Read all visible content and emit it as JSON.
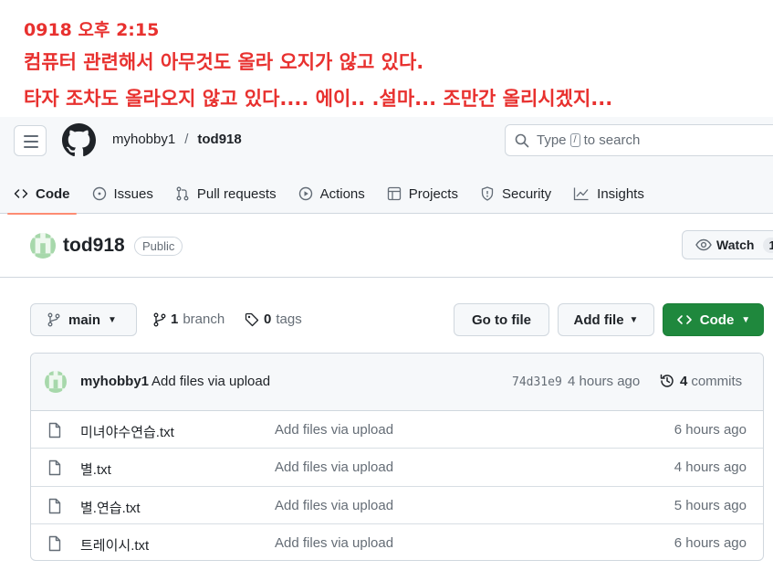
{
  "annotation": {
    "line1": "0918 오후 2:15",
    "line2": "컴퓨터 관련해서 아무것도 올라 오지가 않고 있다.",
    "line3": "타자 조차도 올라오지 않고 있다.... 에이.. .설마... 조만간 올리시겠지..."
  },
  "header": {
    "owner": "myhobby1",
    "separator": "/",
    "repo": "tod918",
    "search_prefix": "Type",
    "search_key": "/",
    "search_suffix": "to search"
  },
  "tabs": [
    {
      "label": "Code",
      "icon": "code-icon",
      "active": true
    },
    {
      "label": "Issues",
      "icon": "issue-icon"
    },
    {
      "label": "Pull requests",
      "icon": "pull-request-icon"
    },
    {
      "label": "Actions",
      "icon": "play-icon"
    },
    {
      "label": "Projects",
      "icon": "table-icon"
    },
    {
      "label": "Security",
      "icon": "shield-icon"
    },
    {
      "label": "Insights",
      "icon": "graph-icon"
    }
  ],
  "repo": {
    "name": "tod918",
    "visibility": "Public",
    "watch_label": "Watch",
    "watch_count": "1"
  },
  "branch_bar": {
    "branch": "main",
    "branch_count": "1",
    "branch_label": "branch",
    "tag_count": "0",
    "tag_label": "tags",
    "go_to_file": "Go to file",
    "add_file": "Add file",
    "code": "Code"
  },
  "latest_commit": {
    "author": "myhobby1",
    "message": "Add files via upload",
    "sha": "74d31e9",
    "time": "4 hours ago",
    "commit_count": "4",
    "commit_label": "commits"
  },
  "files": [
    {
      "name": "미녀야수연습.txt",
      "message": "Add files via upload",
      "time": "6 hours ago"
    },
    {
      "name": "별.txt",
      "message": "Add files via upload",
      "time": "4 hours ago"
    },
    {
      "name": "별.연습.txt",
      "message": "Add files via upload",
      "time": "5 hours ago"
    },
    {
      "name": "트레이시.txt",
      "message": "Add files via upload",
      "time": "6 hours ago"
    }
  ],
  "colors": {
    "annotation": "#e8312f",
    "primary_button": "#1f883d",
    "active_tab_underline": "#fd8c73"
  }
}
